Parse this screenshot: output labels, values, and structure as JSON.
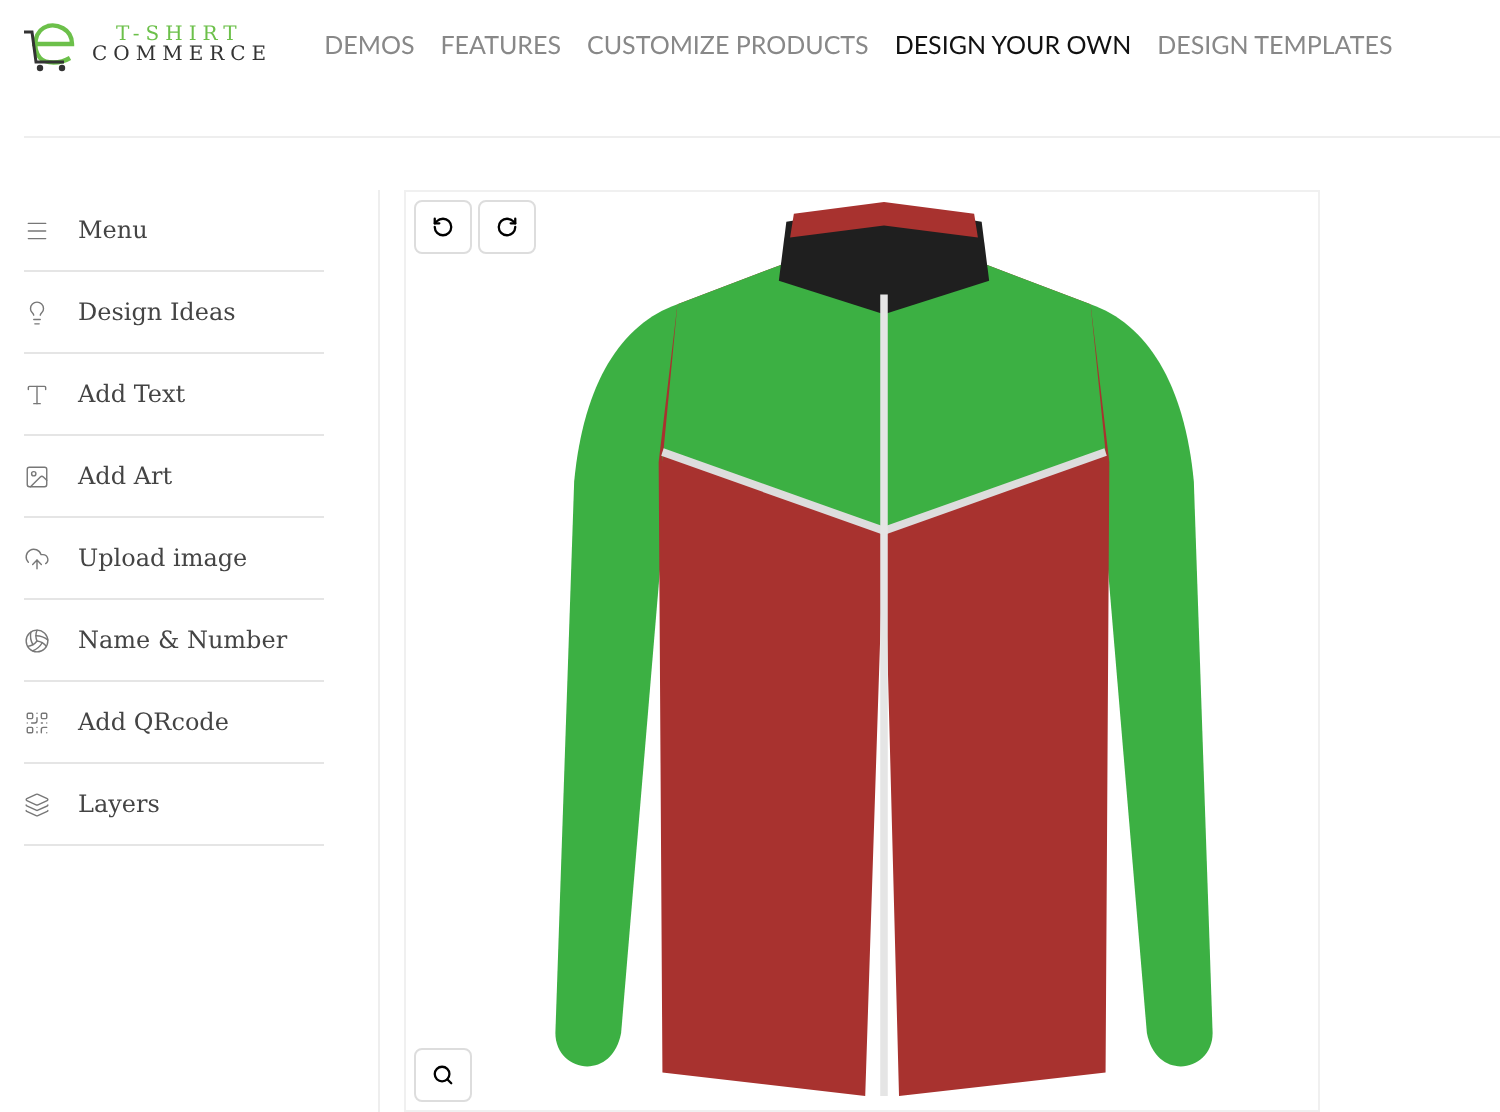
{
  "logo": {
    "top": "T-SHIRT",
    "bottom": "COMMERCE"
  },
  "nav": [
    {
      "label": "DEMOS",
      "selected": false
    },
    {
      "label": "FEATURES",
      "selected": false
    },
    {
      "label": "CUSTOMIZE PRODUCTS",
      "selected": false
    },
    {
      "label": "DESIGN YOUR OWN",
      "selected": true
    },
    {
      "label": "DESIGN TEMPLATES",
      "selected": false
    }
  ],
  "sidebar": {
    "items": [
      {
        "label": "Menu"
      },
      {
        "label": "Design Ideas"
      },
      {
        "label": "Add Text"
      },
      {
        "label": "Add Art"
      },
      {
        "label": "Upload image"
      },
      {
        "label": "Name & Number"
      },
      {
        "label": "Add QRcode"
      },
      {
        "label": "Layers"
      }
    ]
  }
}
